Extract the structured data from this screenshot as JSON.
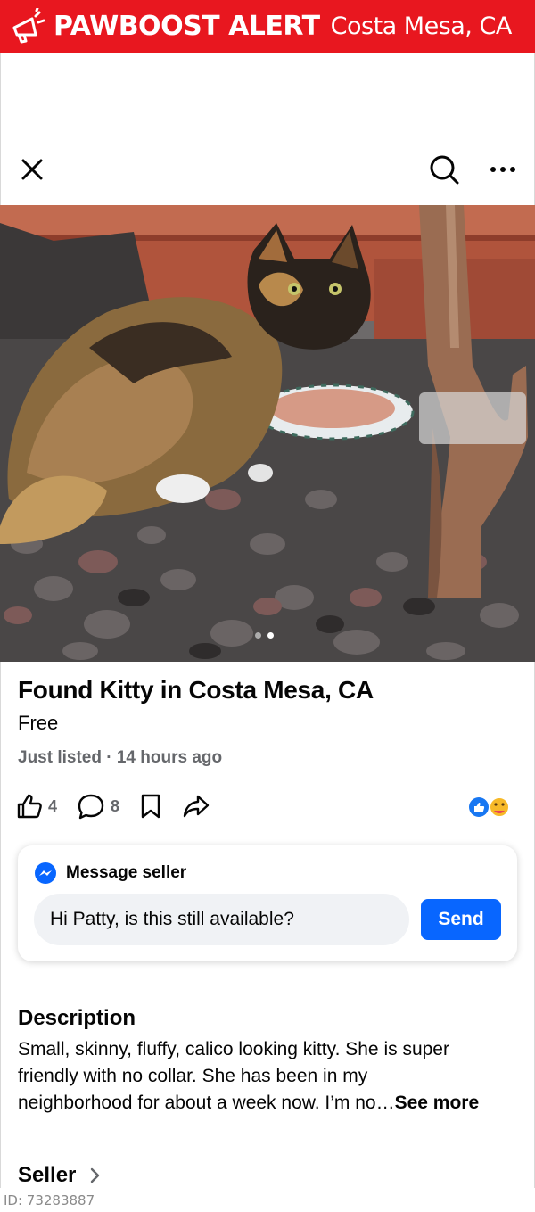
{
  "alert": {
    "brand": "PAWBOOST ALERT",
    "location": "Costa Mesa, CA",
    "icon": "megaphone-icon",
    "color": "#e8171f"
  },
  "topbar": {
    "close_icon": "close-icon",
    "search_icon": "search-icon",
    "more_icon": "more-icon"
  },
  "photo": {
    "carousel_total": 2,
    "carousel_active": 2
  },
  "listing": {
    "title": "Found Kitty in Costa Mesa, CA",
    "price": "Free",
    "meta": "Just listed · 14 hours ago"
  },
  "actions": {
    "likes": "4",
    "comments": "8"
  },
  "message": {
    "header": "Message seller",
    "input_value": "Hi Patty, is this still available?",
    "send_label": "Send",
    "accent": "#0866ff"
  },
  "description": {
    "title": "Description",
    "lines": [
      "Small, skinny, fluffy, calico looking kitty. She is super",
      "friendly with no collar. She has been in my",
      "neighborhood for about a week now. I’m no…"
    ],
    "see_more": "See more"
  },
  "seller": {
    "title": "Seller"
  },
  "footer": {
    "id_label": "ID: 73283887"
  }
}
